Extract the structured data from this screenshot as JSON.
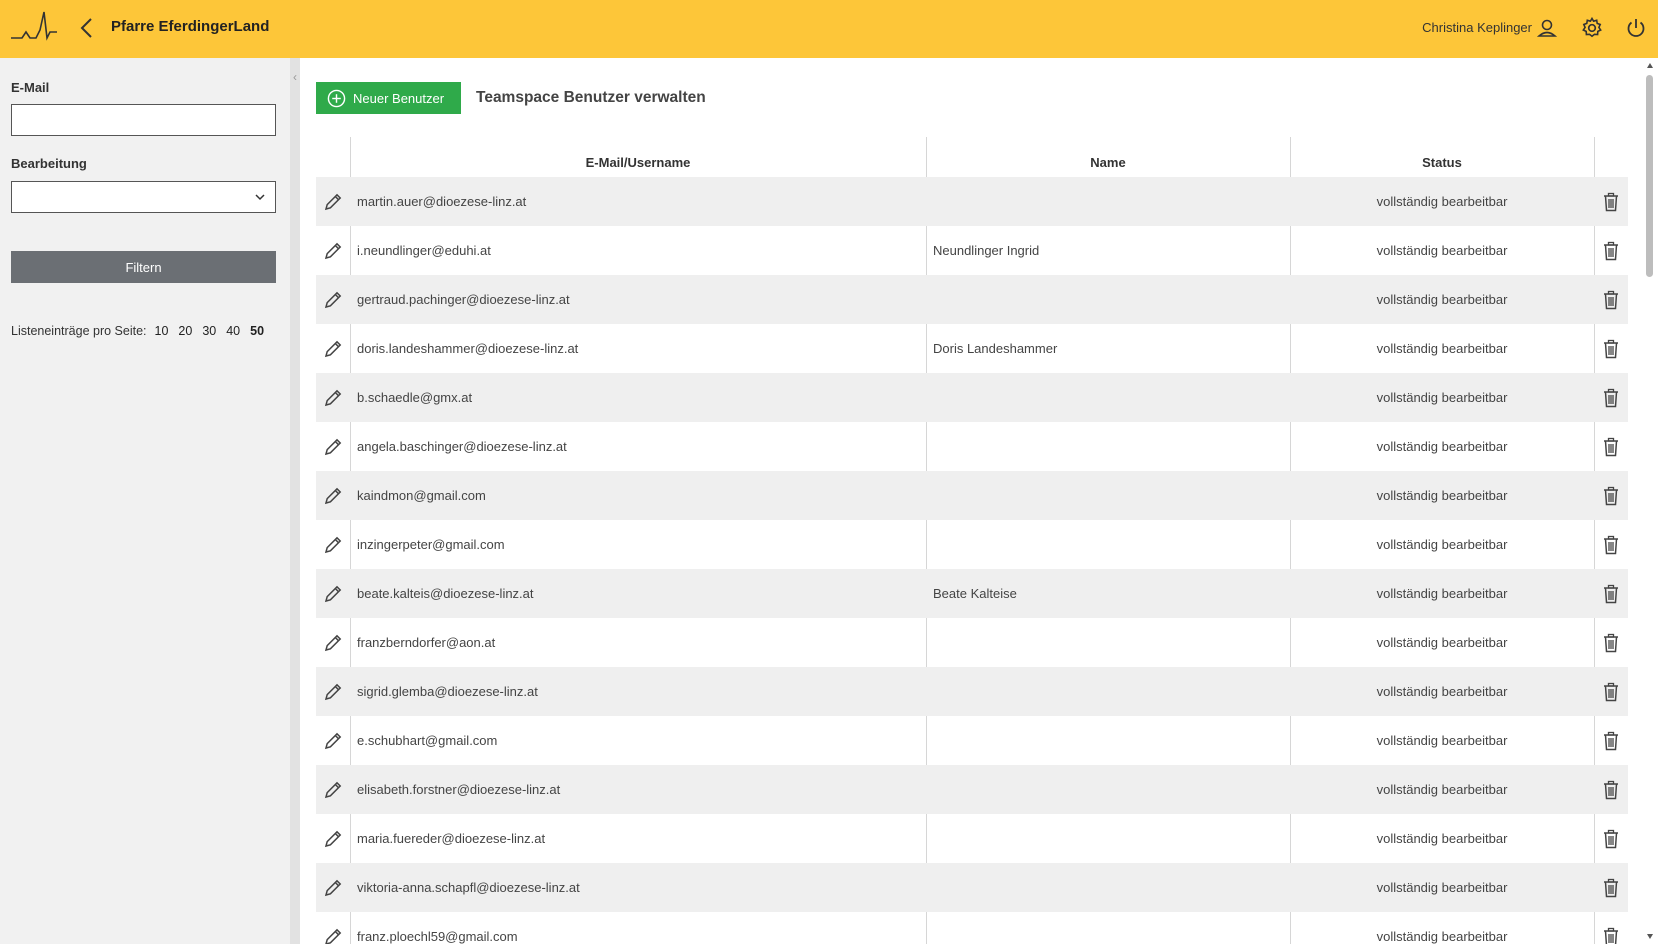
{
  "header": {
    "title": "Pfarre EferdingerLand",
    "user_name": "Christina Keplinger",
    "logo_icon": "heartbeat-logo-icon",
    "back_icon": "chevron-left-icon",
    "user_icon": "user-icon",
    "settings_icon": "gear-icon",
    "logout_icon": "power-icon",
    "bg_color": "#fdc639"
  },
  "sidebar": {
    "email_label": "E-Mail",
    "email_value": "",
    "edit_label": "Bearbeitung",
    "edit_value": "",
    "filter_button": "Filtern",
    "per_page_label": "Listeneinträge pro Seite:",
    "per_page_options": [
      "10",
      "20",
      "30",
      "40",
      "50"
    ],
    "per_page_selected": "50"
  },
  "main": {
    "new_user_button": "Neuer Benutzer",
    "title": "Teamspace Benutzer verwalten",
    "accent_green": "#2faa4a",
    "columns": [
      "E-Mail/Username",
      "Name",
      "Status"
    ],
    "rows": [
      {
        "email": "martin.auer@dioezese-linz.at",
        "name": "",
        "status": "vollständig bearbeitbar"
      },
      {
        "email": "i.neundlinger@eduhi.at",
        "name": "Neundlinger Ingrid",
        "status": "vollständig bearbeitbar"
      },
      {
        "email": "gertraud.pachinger@dioezese-linz.at",
        "name": "",
        "status": "vollständig bearbeitbar"
      },
      {
        "email": "doris.landeshammer@dioezese-linz.at",
        "name": "Doris Landeshammer",
        "status": "vollständig bearbeitbar"
      },
      {
        "email": "b.schaedle@gmx.at",
        "name": "",
        "status": "vollständig bearbeitbar"
      },
      {
        "email": "angela.baschinger@dioezese-linz.at",
        "name": "",
        "status": "vollständig bearbeitbar"
      },
      {
        "email": "kaindmon@gmail.com",
        "name": "",
        "status": "vollständig bearbeitbar"
      },
      {
        "email": "inzingerpeter@gmail.com",
        "name": "",
        "status": "vollständig bearbeitbar"
      },
      {
        "email": "beate.kalteis@dioezese-linz.at",
        "name": "Beate Kalteise",
        "status": "vollständig bearbeitbar"
      },
      {
        "email": "franzberndorfer@aon.at",
        "name": "",
        "status": "vollständig bearbeitbar"
      },
      {
        "email": "sigrid.glemba@dioezese-linz.at",
        "name": "",
        "status": "vollständig bearbeitbar"
      },
      {
        "email": "e.schubhart@gmail.com",
        "name": "",
        "status": "vollständig bearbeitbar"
      },
      {
        "email": "elisabeth.forstner@dioezese-linz.at",
        "name": "",
        "status": "vollständig bearbeitbar"
      },
      {
        "email": "maria.fuereder@dioezese-linz.at",
        "name": "",
        "status": "vollständig bearbeitbar"
      },
      {
        "email": "viktoria-anna.schapfl@dioezese-linz.at",
        "name": "",
        "status": "vollständig bearbeitbar"
      },
      {
        "email": "franz.ploechl59@gmail.com",
        "name": "",
        "status": "vollständig bearbeitbar"
      }
    ],
    "edit_icon": "pencil-icon",
    "delete_icon": "trash-icon"
  }
}
